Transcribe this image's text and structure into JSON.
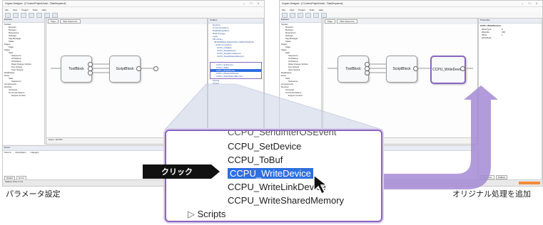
{
  "left_screen": {
    "title": "Cognex Designer - [C:\\Users\\Project\\Jobs\\...\\TaskSequence]",
    "menu": [
      "File",
      "View",
      "Project",
      "Tools",
      "Help"
    ],
    "explorer_title": "Explorer",
    "tree": [
      "System",
      "Devices",
      "Recipes",
      "Resources",
      "Settings",
      "Tag Manager",
      "Tasks",
      "Pages",
      "Page",
      "Tasks",
      "Task",
      "Sequence",
      "OnStartup",
      "OnStartup",
      "Data Change Scripts",
      "Key Scripts",
      "User Scripts",
      "Databases",
      "Tests",
      "Task",
      "Sequence",
      "Components",
      "Devices",
      "Cameras",
      "Communications",
      "Engine Control"
    ],
    "doc_tabs": [
      "Page",
      "Task.Sequence"
    ],
    "blocks": [
      "ToolBlock",
      "ScriptBlock"
    ],
    "zoom": "Zoom: 114.6%",
    "toolbox_title": "Toolbox",
    "toolbox_items": [
      "Devices",
      "Communications",
      "DataManipulation",
      "Data Storage",
      "Logic",
      "FB Library",
      "MITSUBISHI ELECTRIC CORPORATION",
      "CCPU Functions",
      "CCPU_Initialize",
      "CCPU_ReadDevice",
      "CCPU_ReadFromDevice",
      "CCPU_ReadSharedMemory",
      "CCPU_SetDevice",
      "CCPU_ToBuf",
      "CCPU_WriteDevice",
      "CCPU_WriteLinkDevice",
      "CCPU_WriteSharedMemory",
      "Scripts",
      "Others"
    ],
    "bottom_title": "Errors",
    "bottom_cols": [
      "Source",
      "Description",
      "Category"
    ],
    "bottom_tabs": [
      "Output",
      "Errors"
    ],
    "status": "Startup Time: 0 ms"
  },
  "right_screen": {
    "title": "Cognex Designer - [C:\\Users\\Project\\Jobs\\...\\TaskSequence]",
    "menu": [
      "File",
      "View",
      "Project",
      "Tools",
      "Help"
    ],
    "doc_tabs": [
      "Page",
      "Task.Sequence"
    ],
    "blocks": [
      "ToolBlock",
      "ScriptBlock",
      "CCPU_WriteDevice"
    ],
    "properties_title": "Properties",
    "properties_subject": "CCPU_WriteDevice1",
    "properties_rows": [
      [
        "dDevType",
        "0"
      ],
      [
        "dDevNo",
        "100"
      ],
      [
        "dSize",
        "1"
      ],
      [
        "pDevData",
        ""
      ]
    ],
    "properties_tabs": [
      "Properties",
      "Toolbox"
    ]
  },
  "zoom_items": {
    "partial_top": "CCPU_SendInterOSEvent",
    "items": [
      "CCPU_SetDevice",
      "CCPU_ToBuf",
      "CCPU_WriteDevice",
      "CCPU_WriteLinkDevice",
      "CCPU_WriteSharedMemory"
    ],
    "selected": "CCPU_WriteDevice",
    "folder": "Scripts"
  },
  "annotations": {
    "click": "クリック",
    "caption_left": "パラメータ設定",
    "caption_right": "オリジナル処理を追加"
  },
  "colors": {
    "callout_border": "#8a66be",
    "selection": "#2f6fe0",
    "arrow": "#a58ad4"
  }
}
